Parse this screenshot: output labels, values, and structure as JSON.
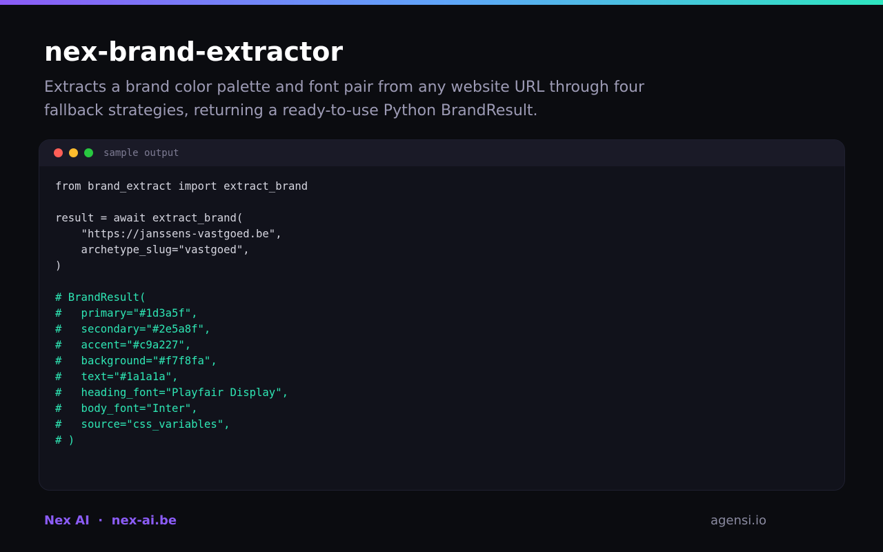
{
  "header": {
    "title": "nex-brand-extractor",
    "subtitle": "Extracts a brand color palette and font pair from any website URL through four fallback strategies, returning a ready-to-use Python BrandResult."
  },
  "code_window": {
    "label": "sample output",
    "lines": [
      {
        "text": "from brand_extract import extract_brand",
        "kind": "plain"
      },
      {
        "text": "",
        "kind": "plain"
      },
      {
        "text": "result = await extract_brand(",
        "kind": "plain"
      },
      {
        "text": "    \"https://janssens-vastgoed.be\",",
        "kind": "plain"
      },
      {
        "text": "    archetype_slug=\"vastgoed\",",
        "kind": "plain"
      },
      {
        "text": ")",
        "kind": "plain"
      },
      {
        "text": "",
        "kind": "plain"
      },
      {
        "text": "# BrandResult(",
        "kind": "comment"
      },
      {
        "text": "#   primary=\"#1d3a5f\",",
        "kind": "comment"
      },
      {
        "text": "#   secondary=\"#2e5a8f\",",
        "kind": "comment"
      },
      {
        "text": "#   accent=\"#c9a227\",",
        "kind": "comment"
      },
      {
        "text": "#   background=\"#f7f8fa\",",
        "kind": "comment"
      },
      {
        "text": "#   text=\"#1a1a1a\",",
        "kind": "comment"
      },
      {
        "text": "#   heading_font=\"Playfair Display\",",
        "kind": "comment"
      },
      {
        "text": "#   body_font=\"Inter\",",
        "kind": "comment"
      },
      {
        "text": "#   source=\"css_variables\",",
        "kind": "comment"
      },
      {
        "text": "# )",
        "kind": "comment"
      }
    ]
  },
  "footer": {
    "brand_text": "Nex AI  ·  nex-ai.be",
    "right_text": "agensi.io"
  },
  "colors": {
    "background": "#0b0c10",
    "accent_purple": "#8b5cf6",
    "accent_teal": "#2ee6b4",
    "code_background": "#11121b"
  }
}
